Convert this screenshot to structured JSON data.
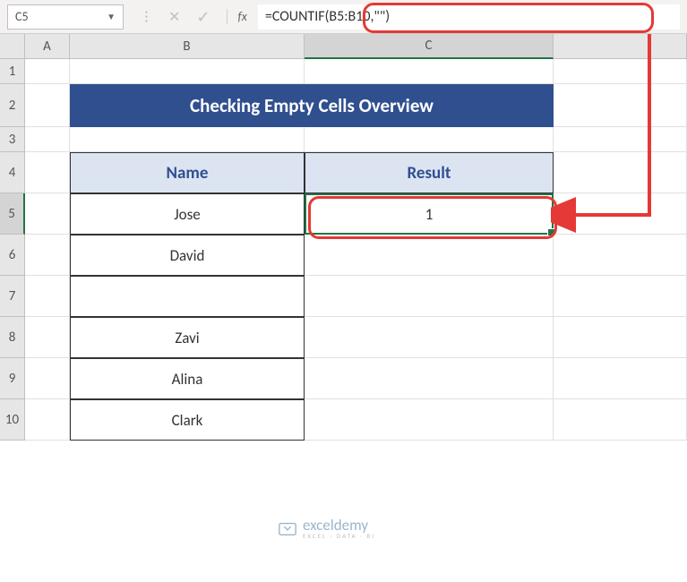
{
  "nameBox": "C5",
  "formula": "=COUNTIF(B5:B10,\"\")",
  "fx_label": "fx",
  "columns": [
    "A",
    "B",
    "C"
  ],
  "rows": [
    "1",
    "2",
    "3",
    "4",
    "5",
    "6",
    "7",
    "8",
    "9",
    "10"
  ],
  "title": "Checking Empty Cells Overview",
  "headers": {
    "name": "Name",
    "result": "Result"
  },
  "data": {
    "names": [
      "Jose",
      "David",
      "",
      "Zavi",
      "Alina",
      "Clark"
    ],
    "result": "1"
  },
  "watermark": {
    "main": "exceldemy",
    "sub": "EXCEL · DATA · BI"
  },
  "chart_data": {
    "type": "table",
    "title": "Checking Empty Cells Overview",
    "columns": [
      "Name",
      "Result"
    ],
    "rows": [
      [
        "Jose",
        1
      ],
      [
        "David",
        ""
      ],
      [
        "",
        ""
      ],
      [
        "Zavi",
        ""
      ],
      [
        "Alina",
        ""
      ],
      [
        "Clark",
        ""
      ]
    ],
    "formula": "=COUNTIF(B5:B10,\"\")",
    "active_cell": "C5"
  }
}
